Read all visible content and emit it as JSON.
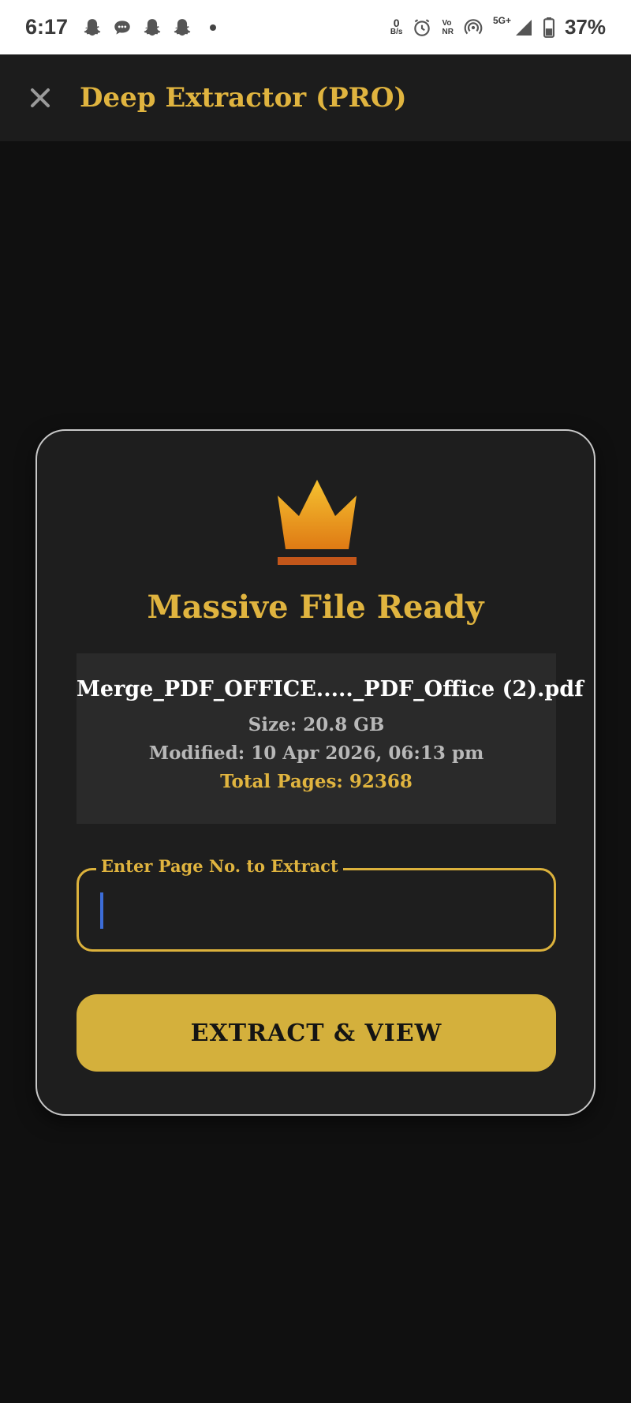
{
  "status_bar": {
    "time": "6:17",
    "net_speed_value": "0",
    "net_speed_unit": "B/s",
    "vonr_top": "Vo",
    "vonr_bottom": "NR",
    "network": "5G+",
    "battery": "37%"
  },
  "app_bar": {
    "title": "Deep Extractor (PRO)",
    "close_icon": "close-icon"
  },
  "dialog": {
    "icon": "crown-icon",
    "heading": "Massive File Ready",
    "file": {
      "name": "Merge_PDF_OFFICE....._PDF_Office (2).pdf",
      "size": "Size: 20.8 GB",
      "modified": "Modified: 10 Apr 2026, 06:13 pm",
      "total_pages": "Total Pages: 92368"
    },
    "page_input": {
      "label": "Enter Page No. to Extract",
      "value": ""
    },
    "extract_button": "EXTRACT & VIEW"
  },
  "colors": {
    "accent_gold": "#e0b43f",
    "button_gold": "#d4b03c",
    "background": "#101010",
    "card": "#1e1e1e",
    "info_box": "#2a2a2a",
    "caret": "#3c6dd8"
  }
}
